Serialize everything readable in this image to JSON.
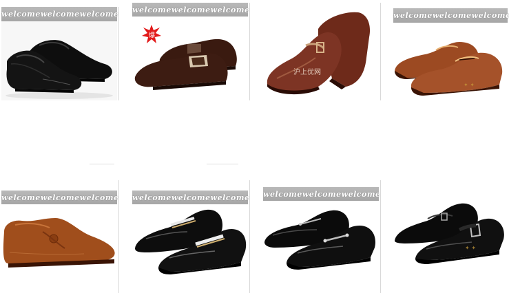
{
  "products": [
    {
      "name": "black-lace-up-oxford",
      "banner": [
        "welcome",
        "welcome",
        "welcome"
      ],
      "watermark": ""
    },
    {
      "name": "brown-suede-slip-on",
      "banner": [
        "welcome",
        "welcome",
        "welcome"
      ],
      "badge": "爆",
      "watermark": ""
    },
    {
      "name": "brown-monk-strap",
      "banner": [],
      "watermark": "沪上优网"
    },
    {
      "name": "tan-oxford",
      "banner": [
        "welcome",
        "welcome",
        "welcome"
      ],
      "watermark": ""
    },
    {
      "name": "tan-button-loafer",
      "banner": [
        "welcome",
        "welcome",
        "welcome"
      ],
      "watermark": ""
    },
    {
      "name": "black-striped-loafer",
      "banner": [
        "welcome",
        "welcome",
        "welcome"
      ],
      "watermark": ""
    },
    {
      "name": "black-bit-loafer",
      "banner": [
        "welcome",
        "welcome",
        "welcome"
      ],
      "watermark": ""
    },
    {
      "name": "black-monk-strap",
      "banner": [],
      "watermark": ""
    }
  ],
  "colors": {
    "banner": "#aaaaaa",
    "black_leather": "#111111",
    "brown_leather": "#7a3424",
    "tan_leather": "#9a4a22",
    "suede": "#3a1a10",
    "badge": "#e21a1a"
  }
}
